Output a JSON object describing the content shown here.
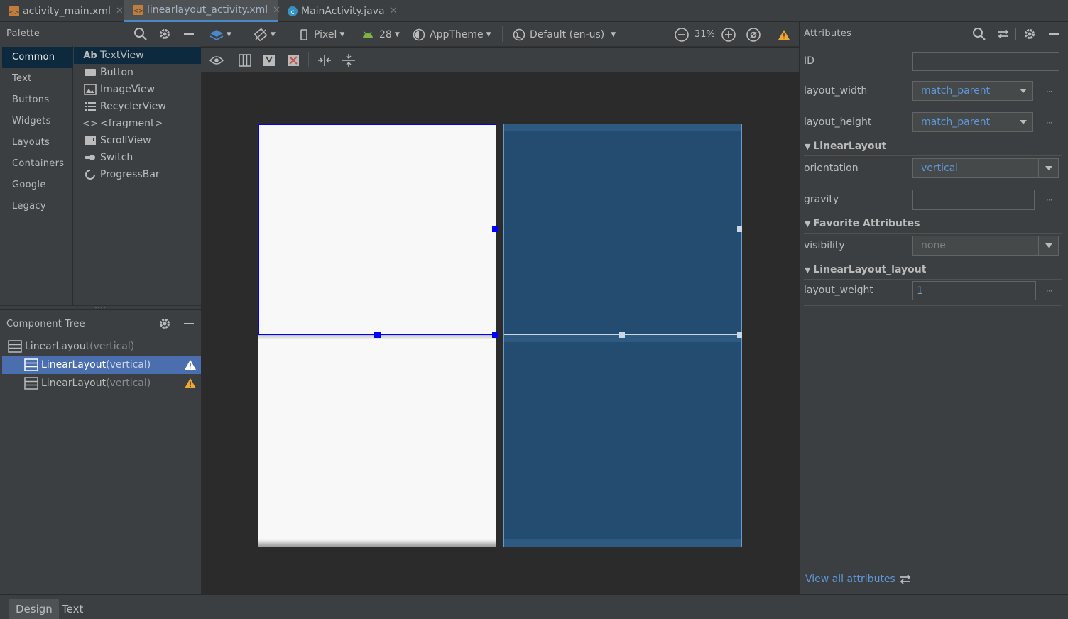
{
  "editor_tabs": [
    {
      "label": "activity_main.xml",
      "icon": "xml-layout-icon",
      "active": false
    },
    {
      "label": "linearlayout_activity.xml",
      "icon": "xml-layout-icon",
      "active": true
    },
    {
      "label": "MainActivity.java",
      "icon": "java-class-icon",
      "active": false
    }
  ],
  "palette": {
    "title": "Palette",
    "categories": [
      "Common",
      "Text",
      "Buttons",
      "Widgets",
      "Layouts",
      "Containers",
      "Google",
      "Legacy"
    ],
    "selected_category": "Common",
    "widgets": [
      {
        "label": "TextView",
        "icon": "textview-icon",
        "glyph": "Ab"
      },
      {
        "label": "Button",
        "icon": "button-icon",
        "glyph": ""
      },
      {
        "label": "ImageView",
        "icon": "imageview-icon",
        "glyph": ""
      },
      {
        "label": "RecyclerView",
        "icon": "recyclerview-icon",
        "glyph": ""
      },
      {
        "label": "<fragment>",
        "icon": "fragment-icon",
        "glyph": "<>"
      },
      {
        "label": "ScrollView",
        "icon": "scrollview-icon",
        "glyph": ""
      },
      {
        "label": "Switch",
        "icon": "switch-icon",
        "glyph": ""
      },
      {
        "label": "ProgressBar",
        "icon": "progressbar-icon",
        "glyph": ""
      }
    ]
  },
  "component_tree": {
    "title": "Component Tree",
    "nodes": [
      {
        "label": "LinearLayout",
        "sub": "(vertical)",
        "warning": false,
        "selected": false
      },
      {
        "label": "LinearLayout",
        "sub": "(vertical)",
        "warning": true,
        "selected": true
      },
      {
        "label": "LinearLayout",
        "sub": "(vertical)",
        "warning": true,
        "selected": false
      }
    ]
  },
  "toolbar": {
    "device": "Pixel",
    "api": "28",
    "theme": "AppTheme",
    "locale": "Default (en-us)",
    "zoom": "31%"
  },
  "attributes": {
    "title": "Attributes",
    "id_label": "ID",
    "id_value": "",
    "layout_width_label": "layout_width",
    "layout_width_value": "match_parent",
    "layout_height_label": "layout_height",
    "layout_height_value": "match_parent",
    "section_linearlayout": "LinearLayout",
    "orientation_label": "orientation",
    "orientation_value": "vertical",
    "gravity_label": "gravity",
    "gravity_value": "",
    "section_favorite": "Favorite Attributes",
    "visibility_label": "visibility",
    "visibility_value": "none",
    "section_layout": "LinearLayout_layout",
    "layout_weight_label": "layout_weight",
    "layout_weight_value": "1",
    "view_all": "View all attributes"
  },
  "bottom_tabs": [
    "Design",
    "Text"
  ],
  "colors": {
    "accent": "#4a88c7",
    "selection": "#4b6eaf",
    "blueprint": "#244c70",
    "warning": "#f0a732",
    "selection_handle": "#0000ff"
  }
}
